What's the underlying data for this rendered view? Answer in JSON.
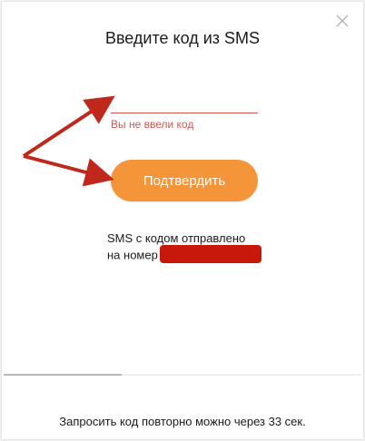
{
  "modal": {
    "title": "Введите код из SMS",
    "close_icon": "close-icon"
  },
  "code_input": {
    "value": "",
    "placeholder": "",
    "error": "Вы не ввели код",
    "error_color": "#d9534f"
  },
  "confirm_button": {
    "label": "Подтвердить",
    "color": "#f5953a"
  },
  "sms_info": {
    "line1": "SMS с кодом отправлено",
    "line2": "на номер",
    "redaction_color": "#c8170b"
  },
  "resend": {
    "text": "Запросить код повторно можно через 33 сек.",
    "progress_fraction": 0.33
  },
  "annotation": {
    "arrow_color": "#c0281c"
  }
}
